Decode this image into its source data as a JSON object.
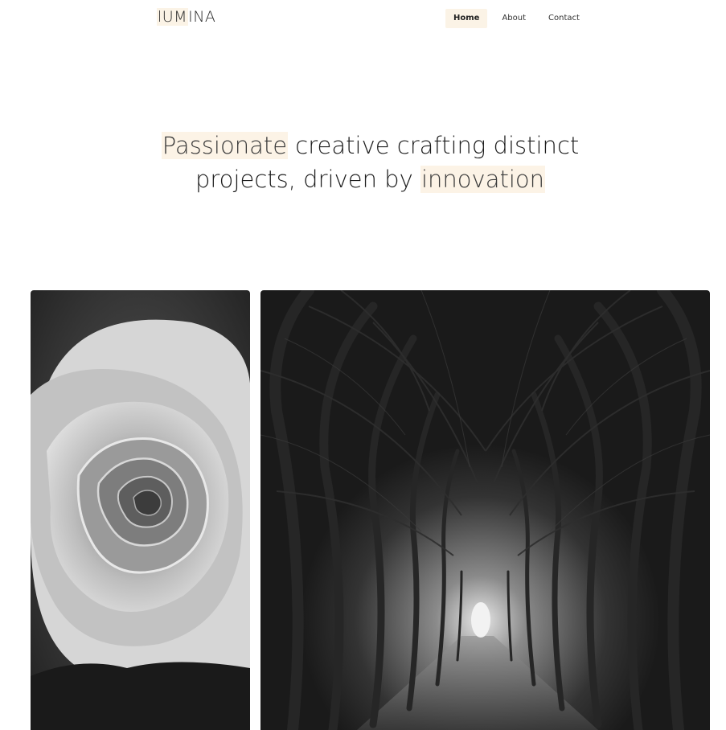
{
  "header": {
    "logo": {
      "highlight": "lUM",
      "rest": "INA"
    },
    "nav": [
      {
        "label": "Home",
        "active": true
      },
      {
        "label": "About",
        "active": false
      },
      {
        "label": "Contact",
        "active": false
      }
    ]
  },
  "hero": {
    "line1_highlight": "Passionate",
    "line1_rest": " creative crafting distinct",
    "line2_start": "projects, driven by ",
    "line2_highlight": "innovation"
  },
  "gallery": {
    "images": [
      {
        "name": "rose-photo",
        "subject": "black and white rose close-up"
      },
      {
        "name": "tree-tunnel-photo",
        "subject": "black and white tree tunnel path"
      }
    ]
  },
  "colors": {
    "highlight": "#fbf3e6",
    "text": "#1d1d1d",
    "background": "#ffffff"
  }
}
